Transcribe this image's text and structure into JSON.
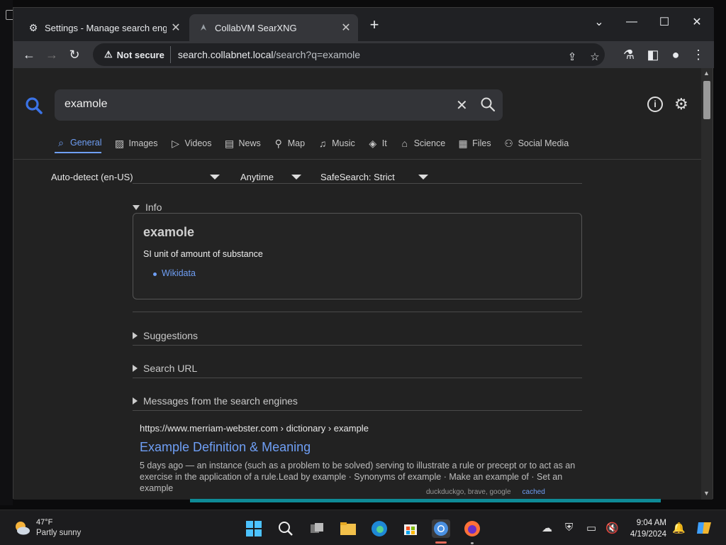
{
  "browser": {
    "tabs": [
      {
        "title": "Settings - Manage search engin",
        "icon": "gear-icon",
        "active": false
      },
      {
        "title": "CollabVM SearXNG",
        "icon": "searxng-icon",
        "active": true
      }
    ],
    "security_label": "Not secure",
    "url_host": "search.collabnet.local",
    "url_path": "/search?q=examole"
  },
  "search": {
    "query": "examole"
  },
  "categories": [
    {
      "label": "General",
      "icon": "search-icon",
      "active": true
    },
    {
      "label": "Images",
      "icon": "image-icon",
      "active": false
    },
    {
      "label": "Videos",
      "icon": "play-icon",
      "active": false
    },
    {
      "label": "News",
      "icon": "newspaper-icon",
      "active": false
    },
    {
      "label": "Map",
      "icon": "map-pin-icon",
      "active": false
    },
    {
      "label": "Music",
      "icon": "music-note-icon",
      "active": false
    },
    {
      "label": "It",
      "icon": "layers-icon",
      "active": false
    },
    {
      "label": "Science",
      "icon": "science-icon",
      "active": false
    },
    {
      "label": "Files",
      "icon": "file-icon",
      "active": false
    },
    {
      "label": "Social Media",
      "icon": "people-icon",
      "active": false
    }
  ],
  "filters": {
    "language": "Auto-detect (en-US)",
    "time_range": "Anytime",
    "safesearch": "SafeSearch: Strict"
  },
  "sections": {
    "info": "Info",
    "suggestions": "Suggestions",
    "search_url": "Search URL",
    "messages": "Messages from the search engines"
  },
  "infobox": {
    "title": "examole",
    "description": "SI unit of amount of substance",
    "link": "Wikidata"
  },
  "result": {
    "url": "https://www.merriam-webster.com  › dictionary › example",
    "title": "Example Definition & Meaning",
    "snippet": "5 days ago — an instance (such as a problem to be solved) serving to illustrate a rule or precept or to act as an exercise in the application of a rule.Lead by example · Synonyms of example · Make an example of · Set an example",
    "engines": "duckduckgo, brave, google",
    "cached": "cached"
  },
  "taskbar": {
    "temperature": "47°F",
    "weather": "Partly sunny",
    "time": "9:04 AM",
    "date": "4/19/2024"
  },
  "colors": {
    "accent": "#6f9ff5",
    "background": "#222222",
    "teal": "#0e8a96"
  }
}
